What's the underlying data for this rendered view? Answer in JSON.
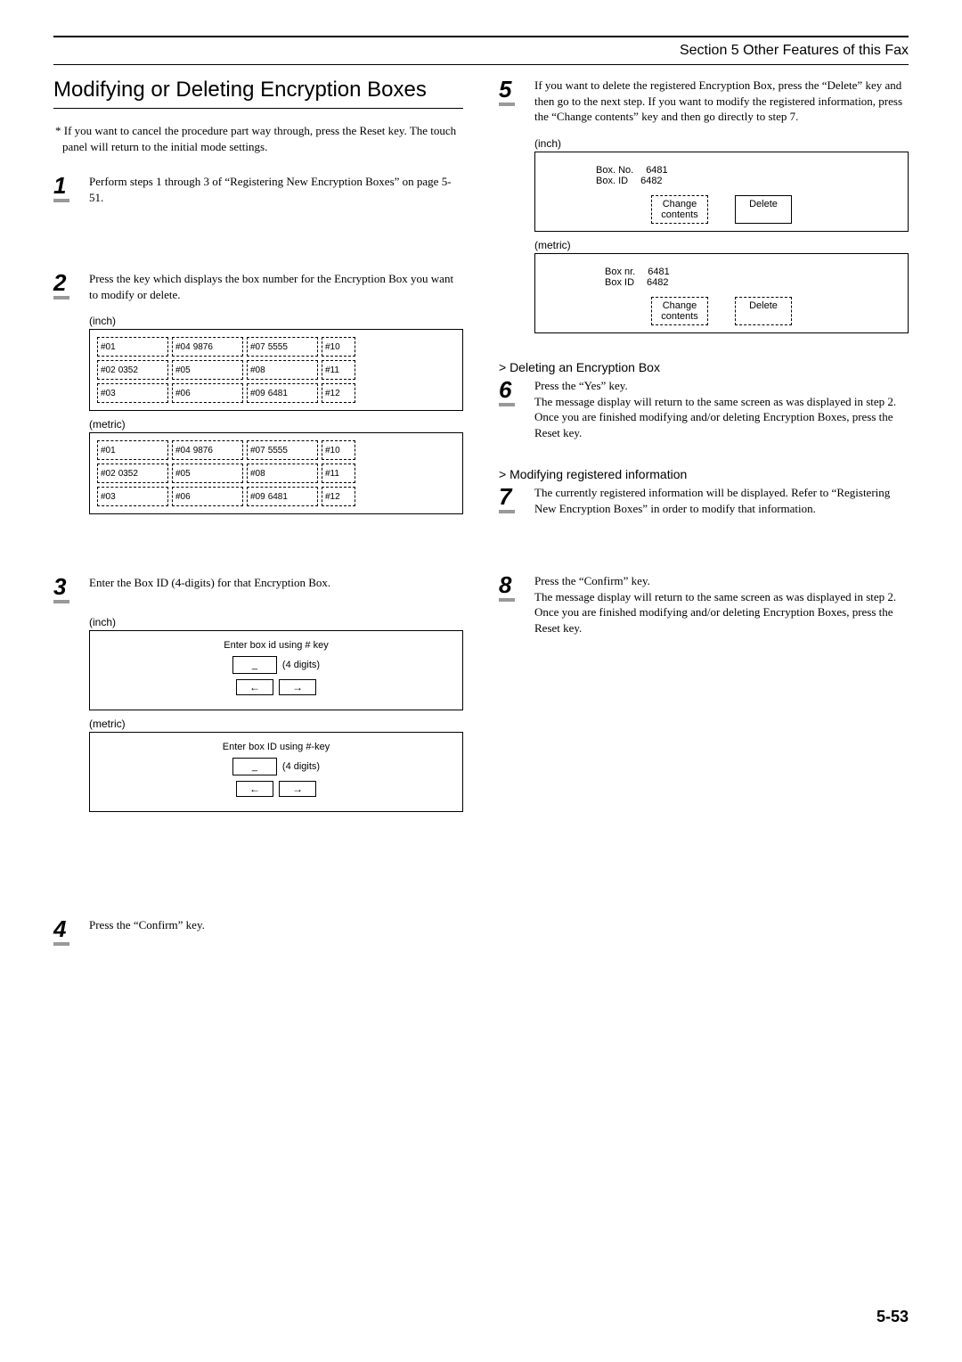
{
  "header": {
    "section": "Section 5  Other Features of this Fax"
  },
  "left": {
    "title": "Modifying or Deleting Encryption Boxes",
    "note": "* If you want to cancel the procedure part way through, press the Reset key. The touch panel will return to the initial mode settings.",
    "step1": "Perform steps 1 through 3 of “Registering New Encryption Boxes” on page 5-51.",
    "step2": "Press the key which displays the box number for the Encryption Box you want to modify or delete.",
    "labels": {
      "inch": "(inch)",
      "metric": "(metric)"
    },
    "grid_inch": {
      "r1": [
        {
          "t": "#01",
          "v": ""
        },
        {
          "t": "#04",
          "v": "9876"
        },
        {
          "t": "#07",
          "v": "5555"
        },
        {
          "t": "#10",
          "v": ""
        }
      ],
      "r2": [
        {
          "t": "#02",
          "v": "0352"
        },
        {
          "t": "#05",
          "v": ""
        },
        {
          "t": "#08",
          "v": ""
        },
        {
          "t": "#11",
          "v": ""
        }
      ],
      "r3": [
        {
          "t": "#03",
          "v": ""
        },
        {
          "t": "#06",
          "v": ""
        },
        {
          "t": "#09",
          "v": "6481"
        },
        {
          "t": "#12",
          "v": ""
        }
      ]
    },
    "grid_metric": {
      "r1": [
        {
          "t": "#01",
          "v": ""
        },
        {
          "t": "#04",
          "v": "9876"
        },
        {
          "t": "#07",
          "v": "5555"
        },
        {
          "t": "#10",
          "v": ""
        }
      ],
      "r2": [
        {
          "t": "#02",
          "v": "0352"
        },
        {
          "t": "#05",
          "v": ""
        },
        {
          "t": "#08",
          "v": ""
        },
        {
          "t": "#11",
          "v": ""
        }
      ],
      "r3": [
        {
          "t": "#03",
          "v": ""
        },
        {
          "t": "#06",
          "v": ""
        },
        {
          "t": "#09",
          "v": "6481"
        },
        {
          "t": "#12",
          "v": ""
        }
      ]
    },
    "step3": "Enter the Box ID (4-digits) for that Encryption Box.",
    "id_inch": {
      "prompt": "Enter box id using # key",
      "digits": "(4 digits)",
      "value": "_"
    },
    "id_metric": {
      "prompt": "Enter box ID using #-key",
      "digits": "(4 digits)",
      "value": "_"
    },
    "step4": "Press the “Confirm” key."
  },
  "right": {
    "step5": "If you want to delete the registered Encryption Box, press the “Delete” key and then go to the next step. If you want to modify the registered information, press the “Change contents” key and then go directly to step 7.",
    "panel_inch": {
      "box_no_label": "Box. No.",
      "box_no_val": "6481",
      "box_id_label": "Box. ID",
      "box_id_val": "6482",
      "change": "Change\ncontents",
      "delete": "Delete"
    },
    "panel_metric": {
      "box_no_label": "Box nr.",
      "box_no_val": "6481",
      "box_id_label": "Box ID",
      "box_id_val": "6482",
      "change": "Change\ncontents",
      "delete": "Delete"
    },
    "sub_delete": "> Deleting an Encryption Box",
    "step6": "Press the “Yes” key.\nThe message display will return to the same screen as was displayed in step 2. Once you are finished modifying and/or deleting Encryption Boxes, press the Reset key.",
    "sub_modify": "> Modifying registered information",
    "step7": "The currently registered information will be displayed. Refer to “Registering New Encryption Boxes” in order to modify that information.",
    "step8": "Press the “Confirm” key.\nThe message display will return to the same screen as was displayed in step 2. Once you are finished modifying and/or deleting Encryption Boxes, press the Reset key."
  },
  "page": "5-53",
  "arrows": {
    "left": "←",
    "right": "→"
  }
}
